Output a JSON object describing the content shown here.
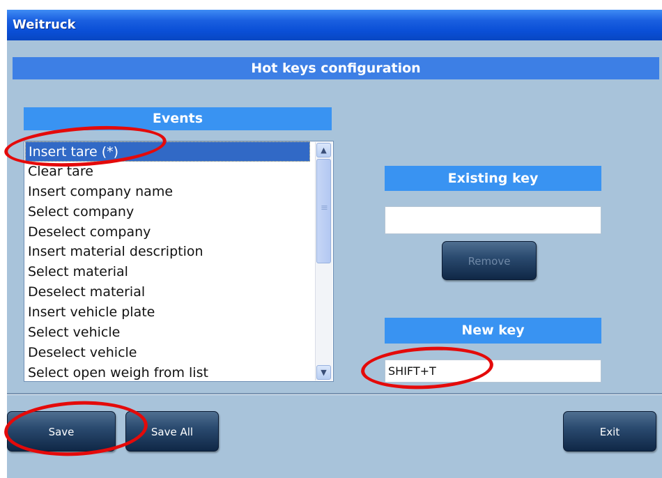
{
  "window": {
    "title": "Weitruck"
  },
  "header": {
    "title": "Hot keys configuration"
  },
  "events": {
    "header": "Events",
    "items": [
      {
        "label": "Insert tare (*)"
      },
      {
        "label": "Clear tare"
      },
      {
        "label": "Insert company name"
      },
      {
        "label": "Select company"
      },
      {
        "label": "Deselect company"
      },
      {
        "label": "Insert material description"
      },
      {
        "label": "Select material"
      },
      {
        "label": "Deselect material"
      },
      {
        "label": "Insert vehicle plate"
      },
      {
        "label": "Select vehicle"
      },
      {
        "label": "Deselect vehicle"
      },
      {
        "label": "Select open weigh from list"
      }
    ],
    "selected_index": 0
  },
  "existing_key": {
    "header": "Existing key",
    "value": "",
    "remove_label": "Remove"
  },
  "new_key": {
    "header": "New key",
    "value": "SHIFT+T"
  },
  "buttons": {
    "save": "Save",
    "save_all": "Save All",
    "exit": "Exit"
  },
  "icons": {
    "scroll_up": "chevron-up-icon",
    "scroll_down": "chevron-down-icon"
  },
  "colors": {
    "annotation": "#e40a0a",
    "selection": "#3169c6",
    "header_blue": "#3993f2"
  }
}
